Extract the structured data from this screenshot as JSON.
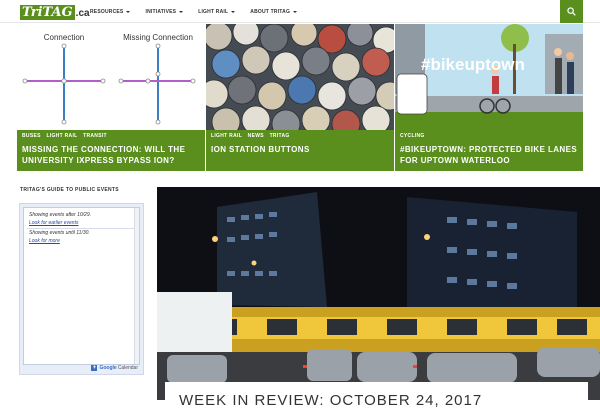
{
  "site": {
    "logo_main": "TriTAG",
    "logo_tld": ".ca"
  },
  "nav": {
    "items": [
      {
        "label": "RESOURCES"
      },
      {
        "label": "INITIATIVES"
      },
      {
        "label": "LIGHT RAIL"
      },
      {
        "label": "ABOUT TRITAG"
      }
    ]
  },
  "featured": [
    {
      "image_text": {
        "left_label": "Connection",
        "right_label": "Missing Connection"
      },
      "categories": [
        "BUSES",
        "LIGHT RAIL",
        "TRANSIT"
      ],
      "title": "MISSING THE CONNECTION: WILL THE UNIVERSITY IXPRESS BYPASS ION?"
    },
    {
      "image_text": {},
      "categories": [
        "LIGHT RAIL",
        "NEWS",
        "TRITAG"
      ],
      "title": "ION STATION BUTTONS"
    },
    {
      "image_text": {
        "hashtag": "#bikeuptown"
      },
      "categories": [
        "CYCLING"
      ],
      "title": "#BIKEUPTOWN: PROTECTED BIKE LANES FOR UPTOWN WATERLOO"
    }
  ],
  "sidebar": {
    "title": "TRITAG'S GUIDE TO PUBLIC EVENTS",
    "calendar": {
      "line1": "Showing events after 10/29.",
      "link1": "Look for earlier events",
      "line2": "Showing events until 11/30.",
      "link2": "Look for more",
      "footer_brand": "Google",
      "footer_product": "Calendar"
    }
  },
  "main_post": {
    "title": "WEEK IN REVIEW: OCTOBER 24, 2017"
  },
  "colors": {
    "accent_green": "#5a8f1d"
  }
}
